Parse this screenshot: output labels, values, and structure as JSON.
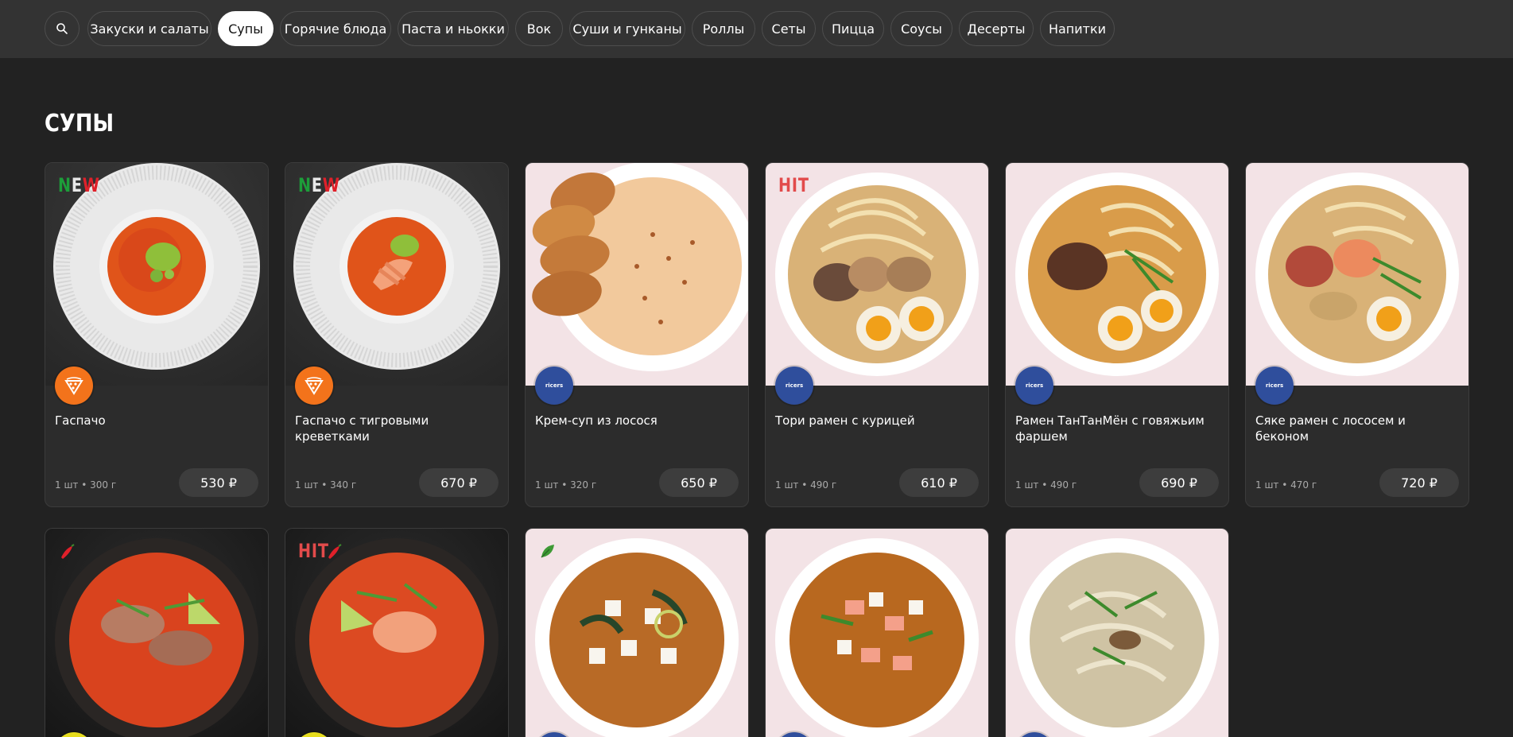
{
  "search": {
    "icon": "search-icon"
  },
  "categories": [
    "Закуски и салаты",
    "Супы",
    "Горячие блюда",
    "Паста и ньокки",
    "Вок",
    "Суши и гунканы",
    "Роллы",
    "Сеты",
    "Пицца",
    "Соусы",
    "Десерты",
    "Напитки"
  ],
  "active_category": "Супы",
  "section": {
    "title": "СУПЫ"
  },
  "badges": {
    "new": "NEW",
    "hit": "HIT"
  },
  "brands": {
    "ricers": "ricers"
  },
  "products": [
    {
      "name": "Гаспачо",
      "weight": "1 шт • 300 г",
      "price": "530 ₽",
      "badge": "NEW",
      "brand": "orange-brand-icon"
    },
    {
      "name": "Гаспачо с тигровыми креветками",
      "weight": "1 шт • 340 г",
      "price": "670 ₽",
      "badge": "NEW",
      "brand": "orange-brand-icon"
    },
    {
      "name": "Крем-суп из лосося",
      "weight": "1 шт • 320 г",
      "price": "650 ₽",
      "badge": "",
      "brand": "ricers"
    },
    {
      "name": "Тори рамен с курицей",
      "weight": "1 шт • 490 г",
      "price": "610 ₽",
      "badge": "HIT",
      "brand": "ricers"
    },
    {
      "name": "Рамен ТанТанМён с говяжьим фаршем",
      "weight": "1 шт • 490 г",
      "price": "690 ₽",
      "badge": "",
      "brand": "ricers"
    },
    {
      "name": "Сяке рамен с лососем и беконом",
      "weight": "1 шт • 470 г",
      "price": "720 ₽",
      "badge": "",
      "brand": "ricers"
    }
  ],
  "row2_badges": [
    "chili-icon",
    "HIT chili-icon",
    "leaf-icon",
    "",
    ""
  ],
  "colors": {
    "background": "#222222",
    "topbar": "#333333",
    "card": "#2c2c2c",
    "price_pill": "#3d3d3d",
    "hit": "#e24b4b",
    "new_green": "#1d9e3a",
    "new_red": "#e0202a",
    "brand_orange": "#f3731b",
    "brand_blue": "#2f4e9c"
  }
}
